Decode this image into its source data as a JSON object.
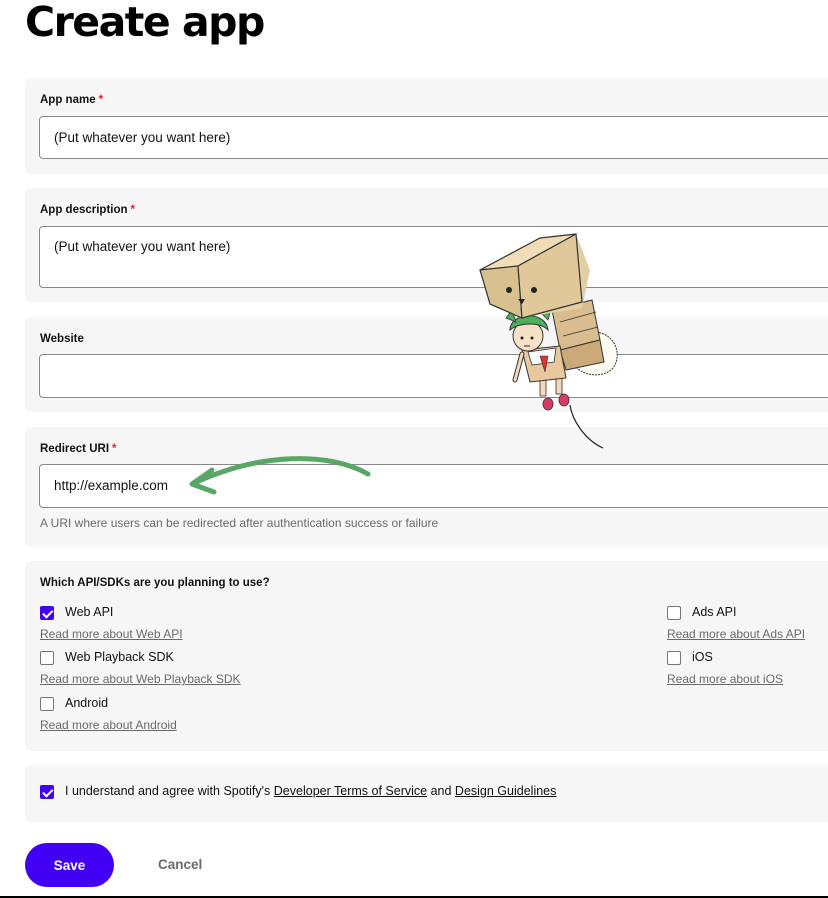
{
  "page": {
    "title": "Create app"
  },
  "form": {
    "required_mark": "*",
    "app_name": {
      "label": "App name",
      "value": "(Put whatever you want here)"
    },
    "app_description": {
      "label": "App description",
      "value": "(Put whatever you want here)"
    },
    "website": {
      "label": "Website",
      "value": ""
    },
    "redirect_uri": {
      "label": "Redirect URI",
      "value": "http://example.com",
      "hint": "A URI where users can be redirected after authentication success or failure"
    },
    "apis": {
      "question": "Which API/SDKs are you planning to use?",
      "options": [
        {
          "label": "Web API",
          "checked": true,
          "link": "Read more about Web API"
        },
        {
          "label": "Web Playback SDK",
          "checked": false,
          "link": "Read more about Web Playback SDK"
        },
        {
          "label": "Android",
          "checked": false,
          "link": "Read more about Android"
        },
        {
          "label": "Ads API",
          "checked": false,
          "link": "Read more about Ads API"
        },
        {
          "label": "iOS",
          "checked": false,
          "link": "Read more about iOS"
        }
      ]
    },
    "agreement": {
      "checked": true,
      "prefix": "I understand and agree with Spotify's",
      "terms_link": "Developer Terms of Service",
      "and": "and",
      "guidelines_link": "Design Guidelines"
    }
  },
  "actions": {
    "save": "Save",
    "cancel": "Cancel"
  },
  "colors": {
    "accent": "#4100f4",
    "required": "#e22134",
    "annotation_arrow": "#5aa667",
    "card_bg": "#f6f6f6"
  },
  "overlay": {
    "sticker": "cardboard-box-mascot-with-green-haired-girl",
    "arrow": "green-arrow-pointing-to-redirect-uri"
  }
}
